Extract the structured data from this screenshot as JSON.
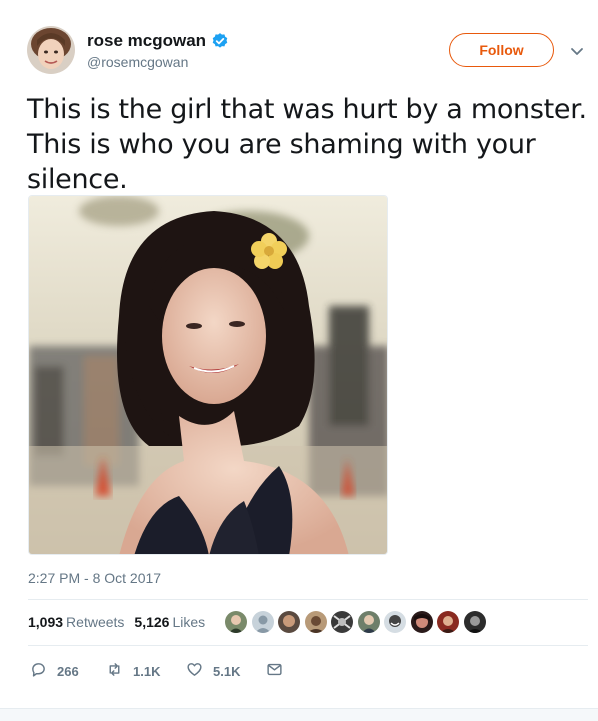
{
  "user": {
    "display_name": "rose mcgowan",
    "handle": "@rosemcgowan",
    "verified": true
  },
  "follow_label": "Follow",
  "tweet_lines": [
    "This is the girl that was hurt by a monster.",
    "This is who you are shaming with your",
    "silence."
  ],
  "timestamp": "2:27 PM - 8 Oct 2017",
  "stats": {
    "retweets_count": "1,093",
    "retweets_label": "Retweets",
    "likes_count": "5,126",
    "likes_label": "Likes"
  },
  "actions": {
    "replies": "266",
    "retweets": "1.1K",
    "likes": "5.1K"
  },
  "colors": {
    "accent": "#e8590c",
    "verified": "#1da1f2",
    "muted": "#657786"
  },
  "icons": [
    "verified-badge-icon",
    "chevron-down-icon",
    "reply-icon",
    "retweet-icon",
    "like-icon",
    "direct-message-icon"
  ]
}
